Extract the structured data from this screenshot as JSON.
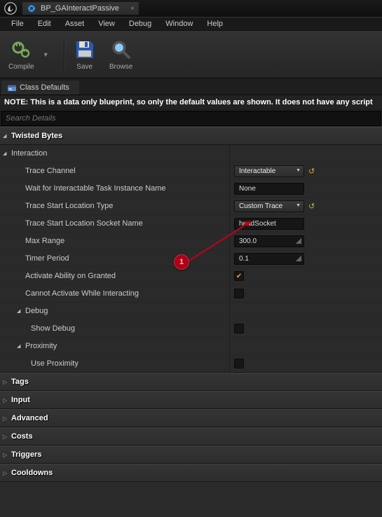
{
  "titlebar": {
    "tab_name": "BP_GAInteractPassive",
    "tab_close": "×"
  },
  "menu": [
    "File",
    "Edit",
    "Asset",
    "View",
    "Debug",
    "Window",
    "Help"
  ],
  "toolbar": {
    "compile": "Compile",
    "save": "Save",
    "browse": "Browse"
  },
  "sectab": {
    "label": "Class Defaults"
  },
  "note": "NOTE: This is a data only blueprint, so only the default values are shown.   It does not have any script",
  "search": {
    "placeholder": "Search Details"
  },
  "cats": {
    "twisted_bytes": "Twisted Bytes",
    "interaction": "Interaction",
    "debug": "Debug",
    "proximity": "Proximity",
    "tags": "Tags",
    "input": "Input",
    "advanced": "Advanced",
    "costs": "Costs",
    "triggers": "Triggers",
    "cooldowns": "Cooldowns"
  },
  "props": {
    "trace_channel": {
      "label": "Trace Channel",
      "value": "Interactable"
    },
    "wait_task": {
      "label": "Wait for Interactable Task Instance Name",
      "value": "None"
    },
    "trace_loc_type": {
      "label": "Trace Start Location Type",
      "value": "Custom Trace"
    },
    "trace_socket": {
      "label": "Trace Start Location Socket Name",
      "value": "headSocket"
    },
    "max_range": {
      "label": "Max Range",
      "value": "300.0"
    },
    "timer_period": {
      "label": "Timer Period",
      "value": "0.1"
    },
    "activate_on_grant": {
      "label": "Activate Ability on Granted",
      "checked": true
    },
    "cannot_activate": {
      "label": "Cannot Activate While Interacting",
      "checked": false
    },
    "show_debug": {
      "label": "Show Debug",
      "checked": false
    },
    "use_proximity": {
      "label": "Use Proximity",
      "checked": false
    }
  },
  "annotation": {
    "label": "1"
  }
}
